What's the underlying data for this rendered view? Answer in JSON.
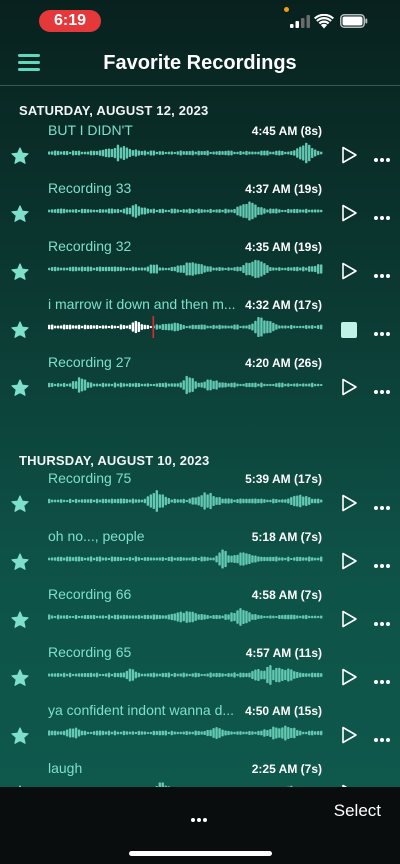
{
  "status_bar": {
    "time": "6:19"
  },
  "header": {
    "title": "Favorite Recordings"
  },
  "sections": [
    {
      "date": "SATURDAY, AUGUST 12, 2023",
      "items": [
        {
          "title": "BUT I DIDN'T",
          "time": "4:45 AM (8s)",
          "state": "idle"
        },
        {
          "title": "Recording 33",
          "time": "4:37 AM (19s)",
          "state": "idle"
        },
        {
          "title": "Recording 32",
          "time": "4:35 AM (19s)",
          "state": "idle"
        },
        {
          "title": "i marrow it down and then m...",
          "time": "4:32 AM (17s)",
          "state": "playing",
          "progress": 0.38
        },
        {
          "title": "Recording 27",
          "time": "4:20 AM (26s)",
          "state": "idle"
        }
      ]
    },
    {
      "date": "THURSDAY, AUGUST 10, 2023",
      "items": [
        {
          "title": "Recording 75",
          "time": "5:39 AM (17s)",
          "state": "idle"
        },
        {
          "title": "oh no..., people",
          "time": "5:18 AM (7s)",
          "state": "idle"
        },
        {
          "title": "Recording 66",
          "time": "4:58 AM (7s)",
          "state": "idle"
        },
        {
          "title": "Recording 65",
          "time": "4:57 AM (11s)",
          "state": "idle"
        },
        {
          "title": "ya confident indont wanna d...",
          "time": "4:50 AM (15s)",
          "state": "idle"
        },
        {
          "title": "laugh",
          "time": "2:25 AM (7s)",
          "state": "idle"
        }
      ]
    }
  ],
  "toolbar": {
    "select_label": "Select"
  },
  "colors": {
    "accent": "#5fd8c0",
    "title_text": "#7ee0cb",
    "wave": "#63c9b3",
    "played_wave": "#ffffff",
    "playhead": "#e0282e"
  }
}
